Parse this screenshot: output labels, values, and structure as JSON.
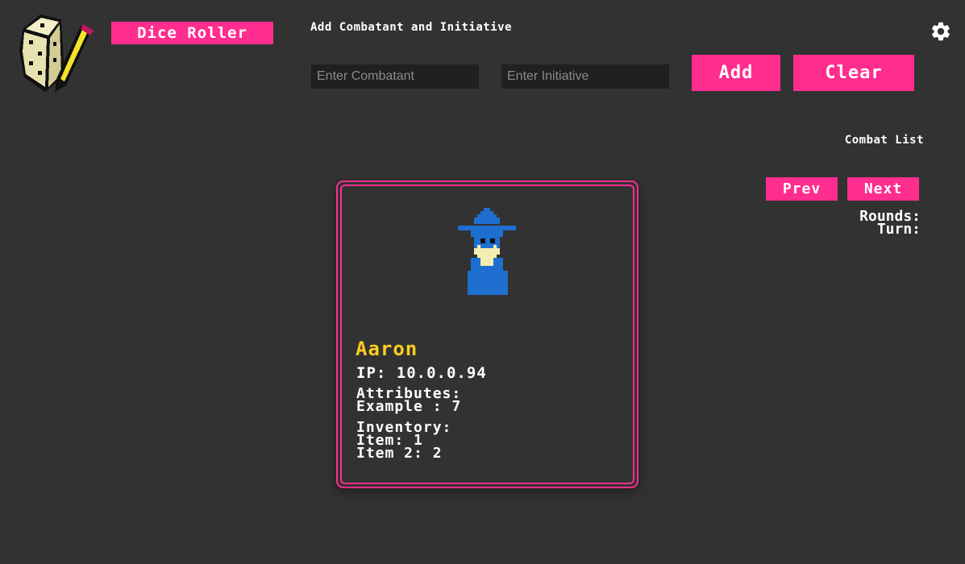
{
  "header": {
    "dice_roller_label": "Dice Roller",
    "form_title": "Add Combatant and Initiative",
    "combatant_placeholder": "Enter Combatant",
    "initiative_placeholder": "Enter Initiative",
    "add_label": "Add",
    "clear_label": "Clear",
    "settings_icon": "gear-icon",
    "logo_icon": "dice-pencil-logo-icon"
  },
  "combat": {
    "list_title": "Combat List",
    "prev_label": "Prev",
    "next_label": "Next",
    "rounds_label": "Rounds:",
    "turn_label": "Turn:"
  },
  "card": {
    "avatar_icon": "wizard-avatar-icon",
    "name": "Aaron",
    "ip": "IP: 10.0.0.94",
    "attributes_title": "Attributes:",
    "attributes": [
      "Example : 7"
    ],
    "inventory_title": "Inventory:",
    "inventory": [
      "Item: 1",
      "Item 2: 2"
    ]
  },
  "colors": {
    "background": "#323232",
    "accent": "#ff2d8e",
    "name": "#ffcd1f",
    "input_bg": "#202020",
    "wizard_blue": "#1e6fd0",
    "wizard_face": "#f2eeb0"
  }
}
